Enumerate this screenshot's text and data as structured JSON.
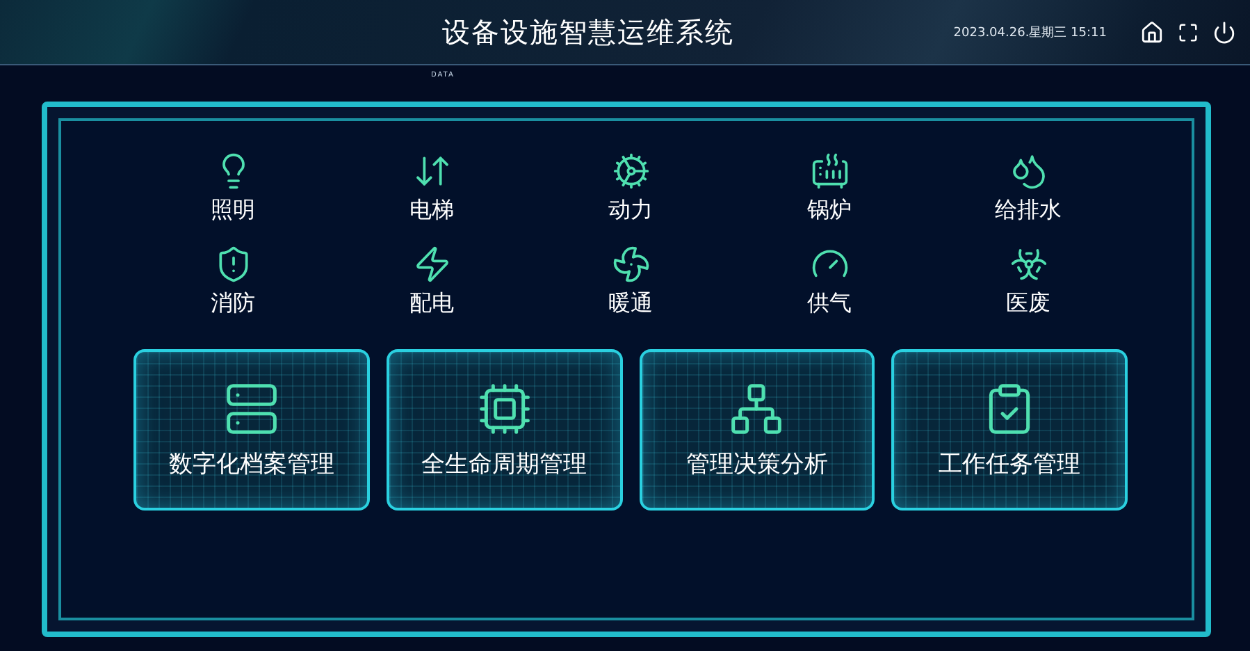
{
  "header": {
    "title": "设备设施智慧运维系统",
    "datetime": "2023.04.26.星期三 15:11"
  },
  "tag": "DATA",
  "systems": [
    {
      "label": "照明"
    },
    {
      "label": "电梯"
    },
    {
      "label": "动力"
    },
    {
      "label": "锅炉"
    },
    {
      "label": "给排水"
    },
    {
      "label": "消防"
    },
    {
      "label": "配电"
    },
    {
      "label": "暖通"
    },
    {
      "label": "供气"
    },
    {
      "label": "医废"
    }
  ],
  "modules": [
    {
      "label": "数字化档案管理"
    },
    {
      "label": "全生命周期管理"
    },
    {
      "label": "管理决策分析"
    },
    {
      "label": "工作任务管理"
    }
  ]
}
